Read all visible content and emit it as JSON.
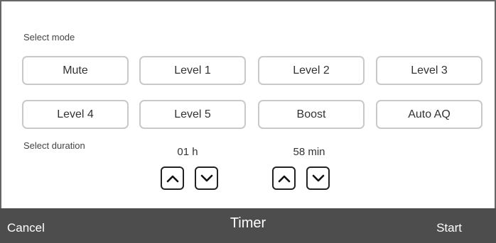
{
  "mode_section": {
    "label": "Select mode",
    "buttons": [
      {
        "label": "Mute"
      },
      {
        "label": "Level 1"
      },
      {
        "label": "Level 2"
      },
      {
        "label": "Level 3"
      },
      {
        "label": "Level 4"
      },
      {
        "label": "Level 5"
      },
      {
        "label": "Boost"
      },
      {
        "label": "Auto AQ"
      }
    ]
  },
  "duration_section": {
    "label": "Select duration",
    "hours": "01 h",
    "minutes": "58 min"
  },
  "footer": {
    "cancel_label": "Cancel",
    "title": "Timer",
    "start_label": "Start",
    "background_color": "#4d4d4d"
  },
  "icons": {
    "increase": "chevron-up-icon",
    "decrease": "chevron-down-icon"
  }
}
